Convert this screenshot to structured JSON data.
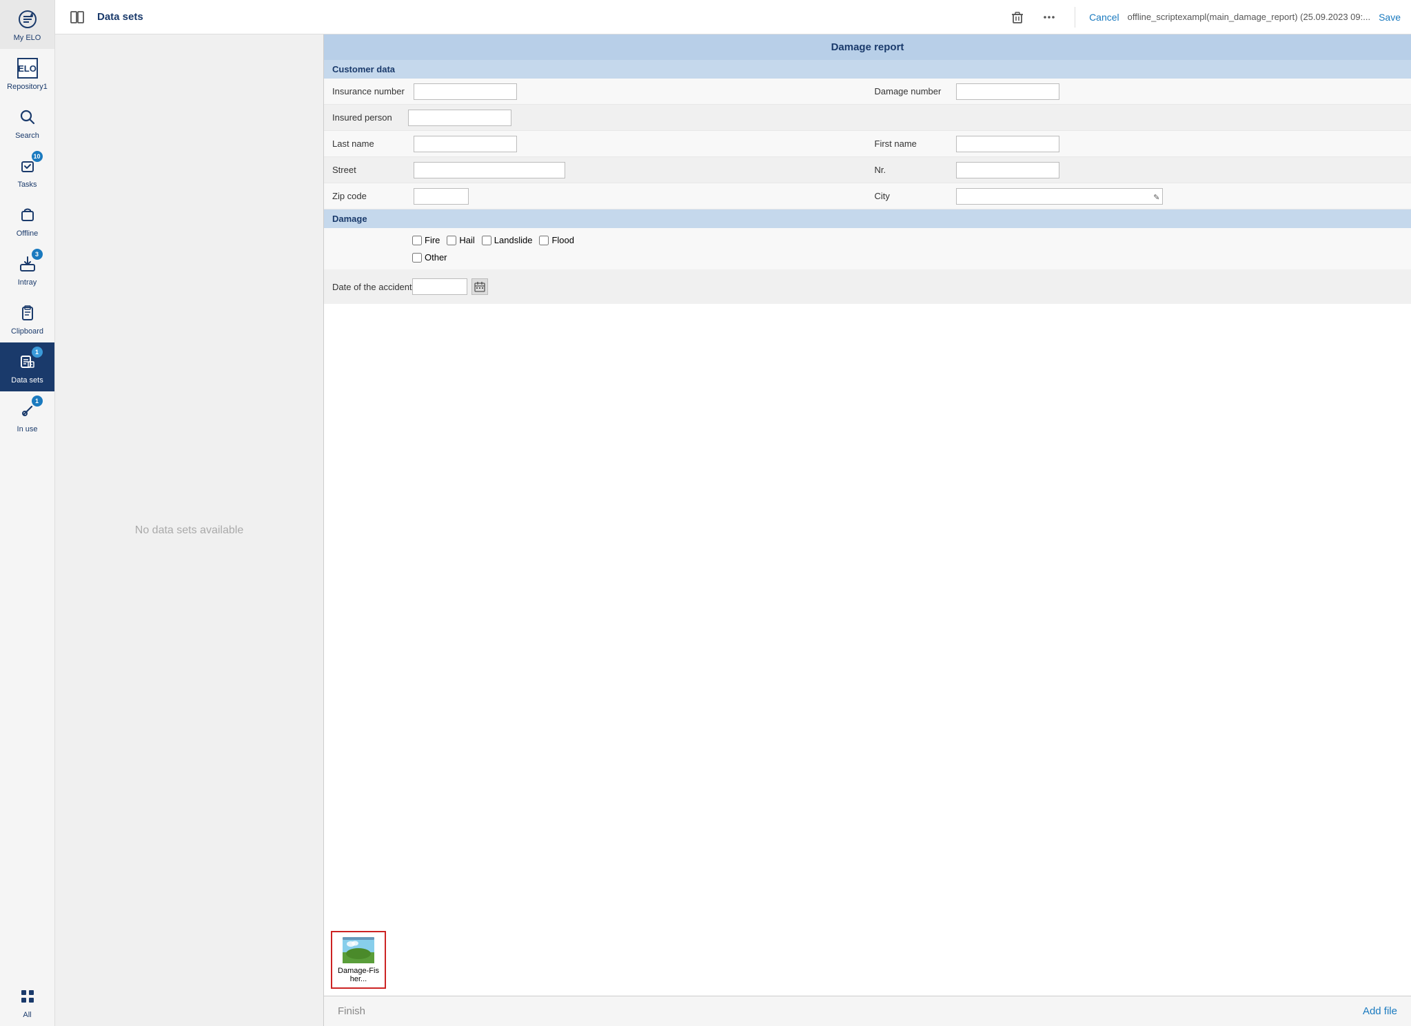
{
  "sidebar": {
    "items": [
      {
        "id": "my-elo",
        "label": "My ELO",
        "icon": "star-icon",
        "badge": null,
        "active": false
      },
      {
        "id": "repository1",
        "label": "Repository1",
        "icon": "folder-icon",
        "badge": null,
        "active": false
      },
      {
        "id": "search",
        "label": "Search",
        "icon": "search-icon",
        "badge": null,
        "active": false
      },
      {
        "id": "tasks",
        "label": "Tasks",
        "icon": "tasks-icon",
        "badge": "10",
        "active": false
      },
      {
        "id": "offline",
        "label": "Offline",
        "icon": "offline-icon",
        "badge": null,
        "active": false
      },
      {
        "id": "intray",
        "label": "Intray",
        "icon": "intray-icon",
        "badge": "3",
        "active": false
      },
      {
        "id": "clipboard",
        "label": "Clipboard",
        "icon": "clipboard-icon",
        "badge": null,
        "active": false
      },
      {
        "id": "data-sets",
        "label": "Data sets",
        "icon": "datasets-icon",
        "badge": "1",
        "active": true
      },
      {
        "id": "in-use",
        "label": "In use",
        "icon": "inuse-icon",
        "badge": "1",
        "active": false
      },
      {
        "id": "all",
        "label": "All",
        "icon": "grid-icon",
        "badge": null,
        "active": false
      }
    ]
  },
  "topbar": {
    "title": "Data sets",
    "cancel_label": "Cancel",
    "file_title": "offline_scriptexampl(main_damage_report) (25.09.2023 09:...",
    "save_label": "Save",
    "more_icon": "more-icon",
    "delete_icon": "delete-icon",
    "panel_icon": "panel-icon"
  },
  "left_panel": {
    "empty_text": "No data sets available"
  },
  "form": {
    "title": "Damage report",
    "customer_section": "Customer data",
    "fields": {
      "insurance_number_label": "Insurance number",
      "insurance_number_value": "",
      "damage_number_label": "Damage number",
      "damage_number_value": "",
      "insured_person_label": "Insured person",
      "insured_person_value": "",
      "last_name_label": "Last name",
      "last_name_value": "",
      "first_name_label": "First name",
      "first_name_value": "",
      "street_label": "Street",
      "street_value": "",
      "nr_label": "Nr.",
      "nr_value": "",
      "zip_code_label": "Zip code",
      "zip_code_value": "",
      "city_label": "City",
      "city_value": ""
    },
    "damage_section": "Damage",
    "damage_types": [
      {
        "id": "fire",
        "label": "Fire",
        "checked": false
      },
      {
        "id": "hail",
        "label": "Hail",
        "checked": false
      },
      {
        "id": "landslide",
        "label": "Landslide",
        "checked": false
      },
      {
        "id": "flood",
        "label": "Flood",
        "checked": false
      },
      {
        "id": "other",
        "label": "Other",
        "checked": false
      }
    ],
    "date_accident_label": "Date of the accident",
    "date_accident_value": ""
  },
  "attachment": {
    "file_name": "Damage-Fisher..."
  },
  "bottom_bar": {
    "finish_label": "Finish",
    "add_file_label": "Add file"
  }
}
